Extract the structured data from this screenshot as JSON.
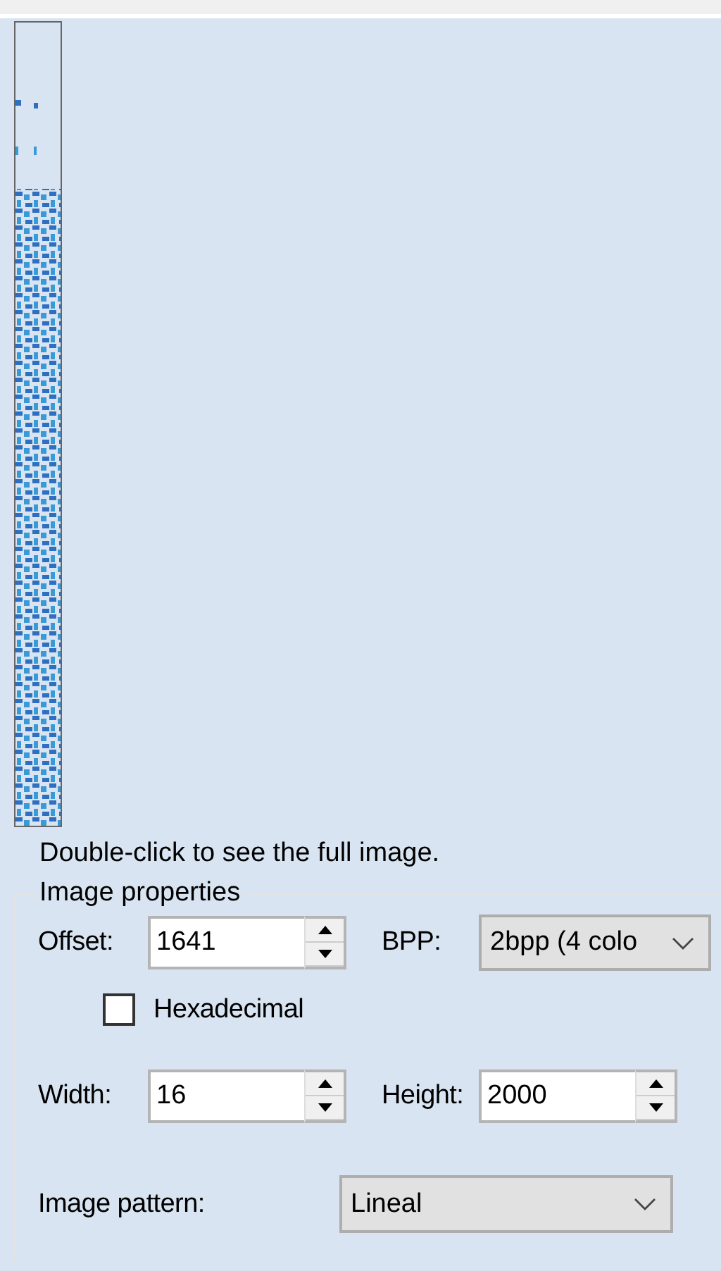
{
  "hint": "Double-click to see the full image.",
  "group": {
    "title": "Image properties",
    "offset": {
      "label": "Offset:",
      "value": "1641"
    },
    "bpp": {
      "label": "BPP:",
      "value": "2bpp (4 colo"
    },
    "hexadecimal": {
      "label": "Hexadecimal",
      "checked": false
    },
    "width": {
      "label": "Width:",
      "value": "16"
    },
    "height": {
      "label": "Height:",
      "value": "2000"
    },
    "pattern": {
      "label": "Image pattern:",
      "value": "Lineal"
    }
  }
}
